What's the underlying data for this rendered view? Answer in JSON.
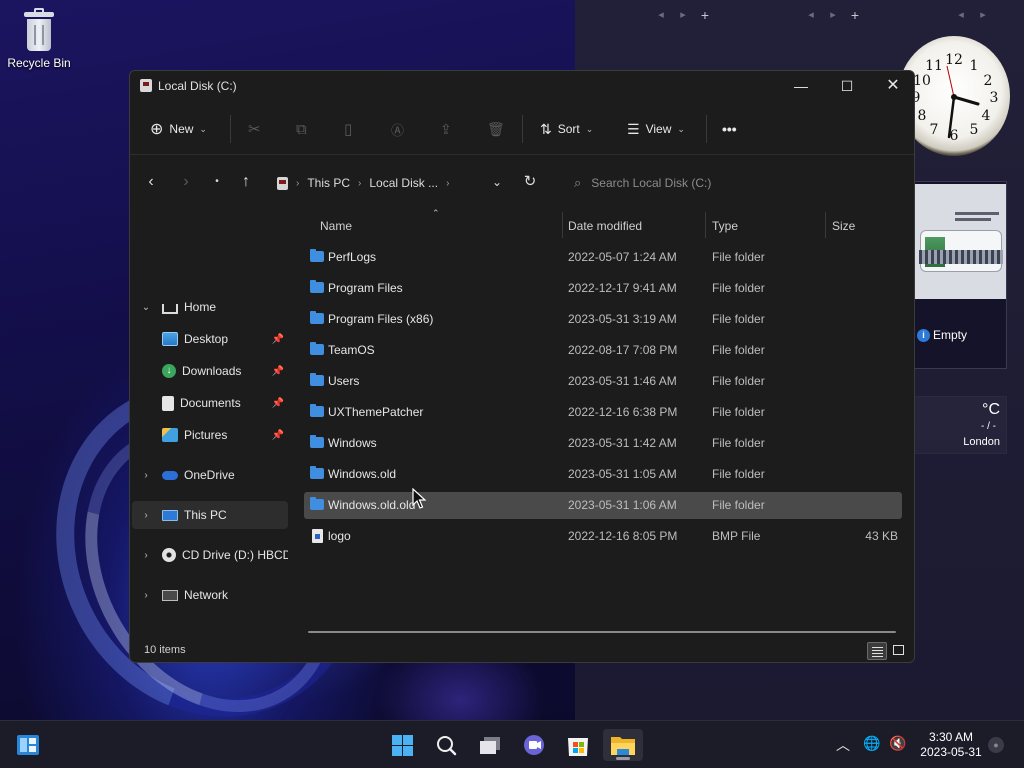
{
  "desktop": {
    "recycle_bin_label": "Recycle Bin",
    "gadgets": {
      "slideshow_status": "Empty",
      "weather_unit": "°C",
      "weather_small": "- / -",
      "weather_city": "London"
    }
  },
  "window": {
    "title": "Local Disk (C:)",
    "toolbar": {
      "new_label": "New",
      "sort_label": "Sort",
      "view_label": "View",
      "more_label": "•••"
    },
    "address": {
      "crumbs": [
        "This PC",
        "Local Disk ..."
      ],
      "search_placeholder": "Search Local Disk (C:)"
    },
    "nav": {
      "home": "Home",
      "desktop": "Desktop",
      "downloads": "Downloads",
      "documents": "Documents",
      "pictures": "Pictures",
      "onedrive": "OneDrive",
      "thispc": "This PC",
      "cddrive": "CD Drive (D:) HBCD_",
      "network": "Network"
    },
    "columns": {
      "name": "Name",
      "date": "Date modified",
      "type": "Type",
      "size": "Size"
    },
    "files": [
      {
        "name": "PerfLogs",
        "date": "2022-05-07 1:24 AM",
        "type": "File folder",
        "size": ""
      },
      {
        "name": "Program Files",
        "date": "2022-12-17 9:41 AM",
        "type": "File folder",
        "size": ""
      },
      {
        "name": "Program Files (x86)",
        "date": "2023-05-31 3:19 AM",
        "type": "File folder",
        "size": ""
      },
      {
        "name": "TeamOS",
        "date": "2022-08-17 7:08 PM",
        "type": "File folder",
        "size": ""
      },
      {
        "name": "Users",
        "date": "2023-05-31 1:46 AM",
        "type": "File folder",
        "size": ""
      },
      {
        "name": "UXThemePatcher",
        "date": "2022-12-16 6:38 PM",
        "type": "File folder",
        "size": ""
      },
      {
        "name": "Windows",
        "date": "2023-05-31 1:42 AM",
        "type": "File folder",
        "size": ""
      },
      {
        "name": "Windows.old",
        "date": "2023-05-31 1:05 AM",
        "type": "File folder",
        "size": ""
      },
      {
        "name": "Windows.old.old",
        "date": "2023-05-31 1:06 AM",
        "type": "File folder",
        "size": ""
      },
      {
        "name": "logo",
        "date": "2022-12-16 8:05 PM",
        "type": "BMP File",
        "size": "43 KB"
      }
    ],
    "status": "10 items"
  },
  "taskbar": {
    "time": "3:30 AM",
    "date": "2023-05-31"
  },
  "colors": {
    "accent": "#4ab1f2",
    "folder": "#3f8ee0",
    "selection": "#4a4a4a"
  }
}
